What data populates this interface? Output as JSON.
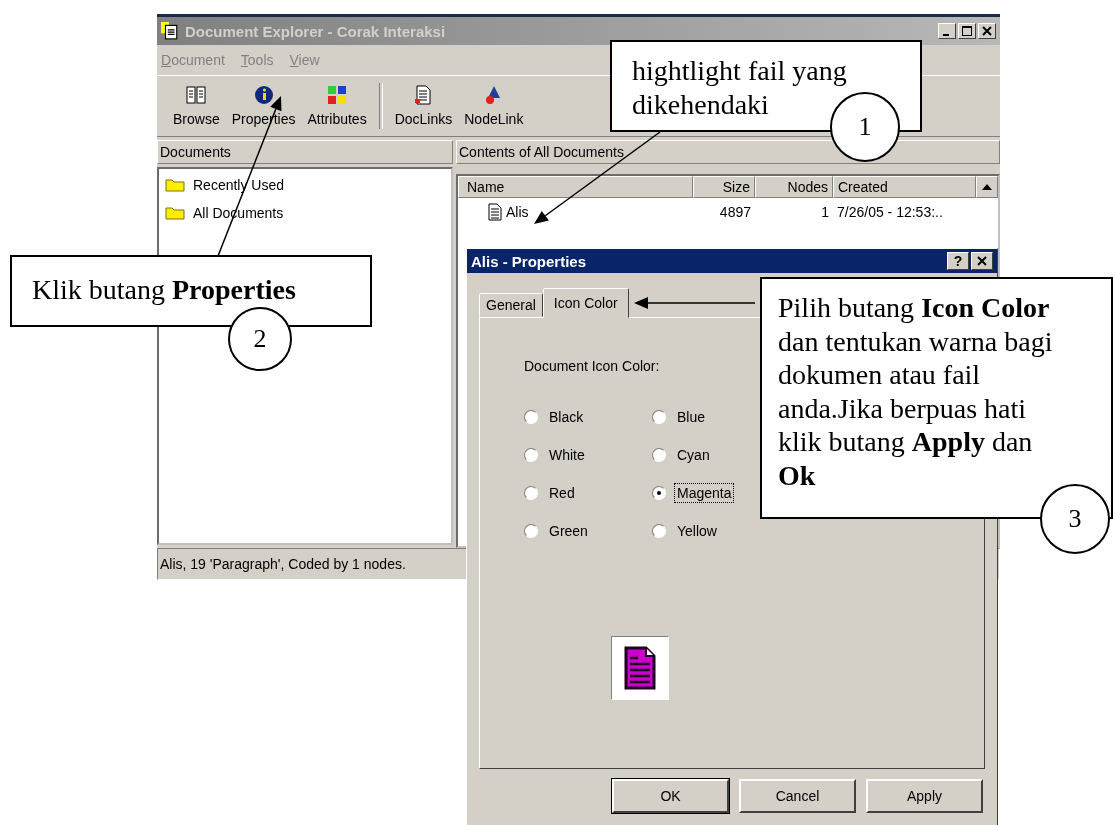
{
  "window": {
    "title": "Document Explorer - Corak Interaksi"
  },
  "menu": [
    "Document",
    "Tools",
    "View"
  ],
  "toolbar": [
    {
      "label": "Browse",
      "kind": "book"
    },
    {
      "label": "Properties",
      "kind": "info"
    },
    {
      "label": "Attributes",
      "kind": "grid"
    },
    {
      "label": "DocLinks",
      "kind": "doclink"
    },
    {
      "label": "NodeLink",
      "kind": "nodelink"
    }
  ],
  "documents_panel": {
    "title": "Documents",
    "items": [
      {
        "label": "Recently Used"
      },
      {
        "label": "All Documents"
      }
    ]
  },
  "contents_panel": {
    "title": "Contents of All Documents",
    "columns": [
      "Name",
      "Size",
      "Nodes",
      "Created"
    ],
    "rows": [
      {
        "name": "Alis",
        "size": "4897",
        "nodes": "1",
        "created": "7/26/05 - 12:53:.."
      }
    ]
  },
  "status_bar": "Alis, 19 'Paragraph', Coded by 1 nodes.",
  "dialog": {
    "title": "Alis - Properties",
    "help": "?",
    "tabs": [
      {
        "label": "General",
        "selected": false
      },
      {
        "label": "Icon Color",
        "selected": true
      }
    ],
    "group_label": "Document Icon Color:",
    "options": [
      {
        "label": "Black",
        "selected": false
      },
      {
        "label": "White",
        "selected": false
      },
      {
        "label": "Red",
        "selected": false
      },
      {
        "label": "Green",
        "selected": false
      },
      {
        "label": "Blue",
        "selected": false
      },
      {
        "label": "Cyan",
        "selected": false
      },
      {
        "label": "Magenta",
        "selected": true
      },
      {
        "label": "Yellow",
        "selected": false
      }
    ],
    "preview": {
      "color": "#cc00cc"
    },
    "buttons": [
      {
        "label": "OK",
        "default": true
      },
      {
        "label": "Cancel",
        "default": false
      },
      {
        "label": "Apply",
        "default": false
      }
    ]
  },
  "callouts": [
    {
      "number": "1",
      "text": "hightlight fail yang dikehendaki"
    },
    {
      "number": "2",
      "text": "Klik butang **Properties**"
    },
    {
      "number": "3",
      "text": "Pilih butang **Icon Color** dan tentukan warna bagi dokumen atau fail anda.Jika berpuas hati klik butang **Apply** dan **Ok**"
    }
  ]
}
